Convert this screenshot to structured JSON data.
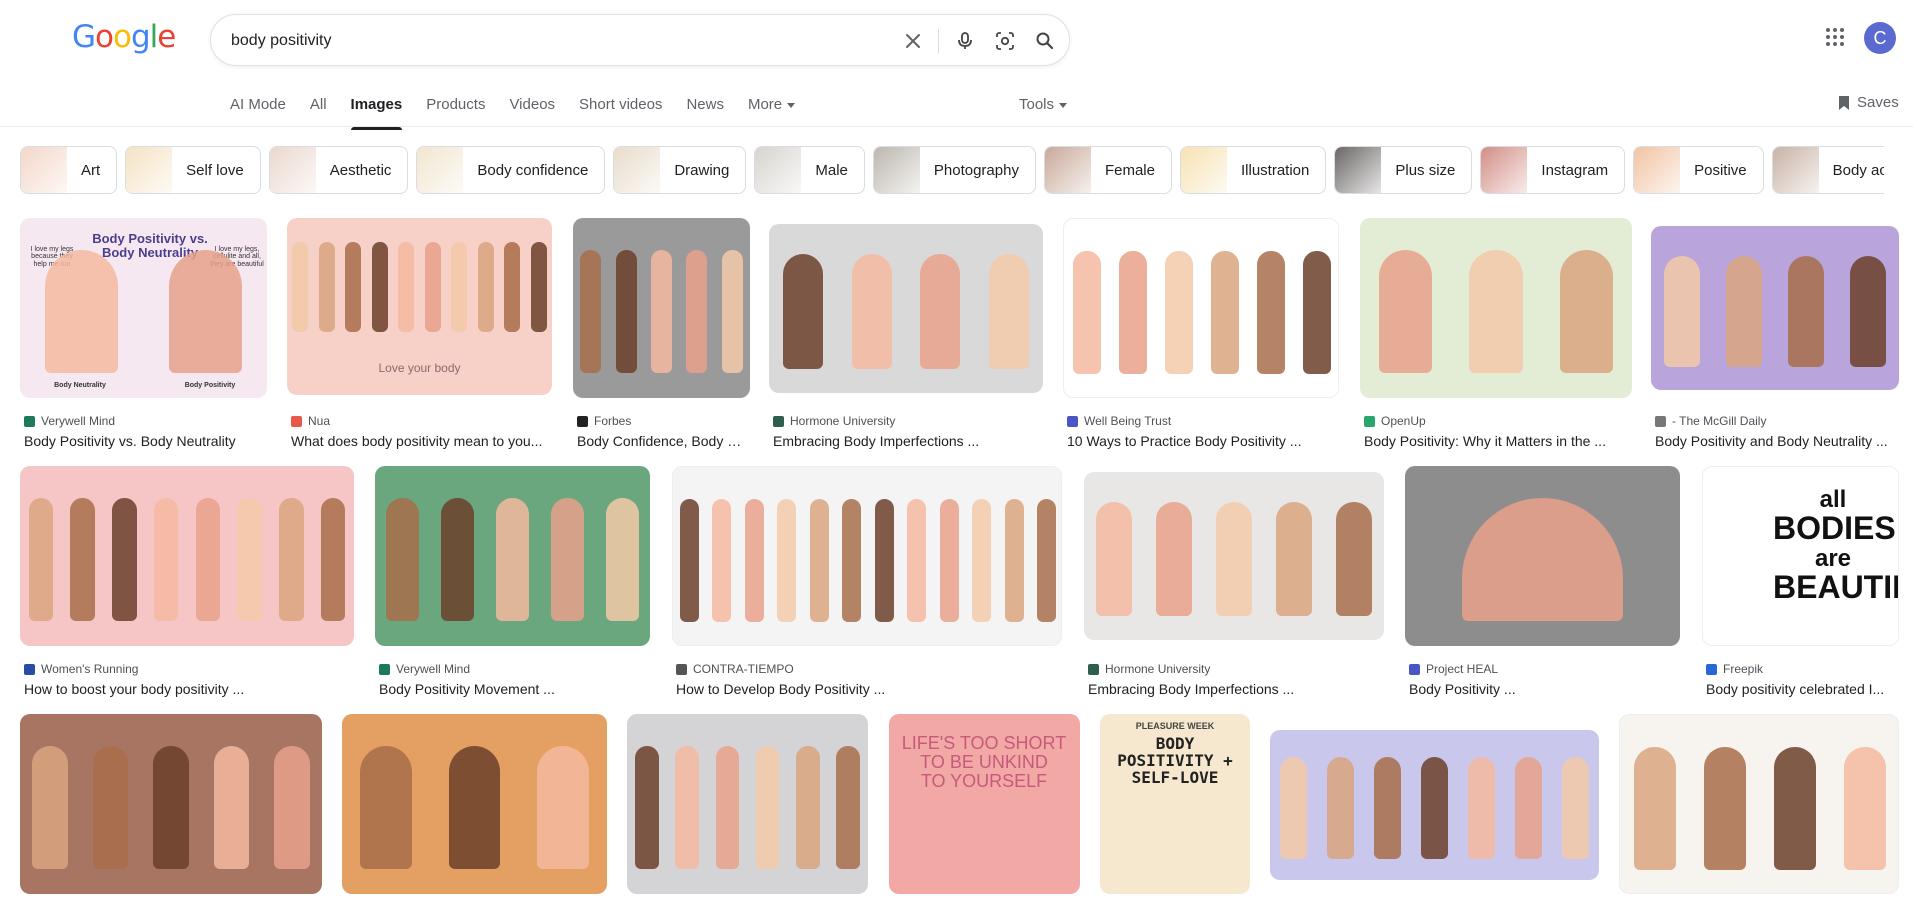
{
  "header": {
    "logo_letters": [
      {
        "ch": "G",
        "color": "#4285f4"
      },
      {
        "ch": "o",
        "color": "#ea4335"
      },
      {
        "ch": "o",
        "color": "#fbbc05"
      },
      {
        "ch": "g",
        "color": "#4285f4"
      },
      {
        "ch": "l",
        "color": "#34a853"
      },
      {
        "ch": "e",
        "color": "#ea4335"
      }
    ],
    "search_value": "body positivity",
    "avatar_letter": "C",
    "icons": [
      "close-icon",
      "mic-icon",
      "lens-icon",
      "search-icon",
      "apps-icon"
    ]
  },
  "nav": {
    "tabs": [
      "AI Mode",
      "All",
      "Images",
      "Products",
      "Videos",
      "Short videos",
      "News",
      "More"
    ],
    "active": "Images",
    "tools": "Tools",
    "saves": "Saves"
  },
  "chips": [
    {
      "label": "Art",
      "c": "#f3d7c9"
    },
    {
      "label": "Self love",
      "c": "#f4e3c4"
    },
    {
      "label": "Aesthetic",
      "c": "#ead8cf"
    },
    {
      "label": "Body confidence",
      "c": "#f1e6cf"
    },
    {
      "label": "Drawing",
      "c": "#e9dccb"
    },
    {
      "label": "Male",
      "c": "#d8d4cf"
    },
    {
      "label": "Photography",
      "c": "#bcb6ae"
    },
    {
      "label": "Female",
      "c": "#c9a99a"
    },
    {
      "label": "Illustration",
      "c": "#f7e2b3"
    },
    {
      "label": "Plus size",
      "c": "#6b6766"
    },
    {
      "label": "Instagram",
      "c": "#d38e86"
    },
    {
      "label": "Positive",
      "c": "#f2c3a2"
    },
    {
      "label": "Body acceptance",
      "c": "#c8b2a5"
    }
  ],
  "results": [
    {
      "source": "Verywell Mind",
      "title": "Body Positivity vs. Body Neutrality",
      "bg": "#f6e8f1",
      "fav": "#1a7a5b"
    },
    {
      "source": "Nua",
      "title": "What does body positivity mean to you...",
      "bg": "#f7d1c8",
      "fav": "#e8594a"
    },
    {
      "source": "Forbes",
      "title": "Body Confidence, Body P...",
      "bg": "#9a9a9a",
      "fav": "#222222"
    },
    {
      "source": "Hormone University",
      "title": "Embracing Body Imperfections ...",
      "bg": "#d9d9d9",
      "fav": "#2e5e4e"
    },
    {
      "source": "Well Being Trust",
      "title": "10 Ways to Practice Body Positivity ...",
      "bg": "#ffffff",
      "fav": "#4a56c6"
    },
    {
      "source": "OpenUp",
      "title": "Body Positivity: Why it Matters in the ...",
      "bg": "#e3ecd5",
      "fav": "#29a56e"
    },
    {
      "source": "- The McGill Daily",
      "title": "Body Positivity and Body Neutrality ...",
      "bg": "#b9a5dc",
      "fav": "#777777"
    },
    {
      "source": "Women's Running",
      "title": "How to boost your body positivity ...",
      "bg": "#f6c6c6",
      "fav": "#2a4aa8"
    },
    {
      "source": "Verywell Mind",
      "title": "Body Positivity Movement ...",
      "bg": "#6aa67e",
      "fav": "#1a7a5b"
    },
    {
      "source": "CONTRA-TIEMPO",
      "title": "How to Develop Body Positivity ...",
      "bg": "#f4f4f4",
      "fav": "#555555"
    },
    {
      "source": "Hormone University",
      "title": "Embracing Body Imperfections ...",
      "bg": "#e9e7e6",
      "fav": "#2e5e4e"
    },
    {
      "source": "Project HEAL",
      "title": "Body Positivity ...",
      "bg": "#8c8d8c",
      "fav": "#4a56c6"
    },
    {
      "source": "Freepik",
      "title": "Body positivity celebrated I...",
      "bg": "#ffffff",
      "fav": "#2a67d6"
    },
    {
      "source": "",
      "title": "",
      "bg": "#a87562",
      "fav": ""
    },
    {
      "source": "",
      "title": "",
      "bg": "#e3a062",
      "fav": ""
    },
    {
      "source": "",
      "title": "",
      "bg": "#d4d4d6",
      "fav": ""
    },
    {
      "source": "",
      "title": "",
      "bg": "#f2a9a5",
      "fav": ""
    },
    {
      "source": "",
      "title": "",
      "bg": "#f6e8cf",
      "fav": ""
    },
    {
      "source": "",
      "title": "",
      "bg": "#c9c8ec",
      "fav": ""
    },
    {
      "source": "",
      "title": "",
      "bg": "#f7f3ef",
      "fav": ""
    }
  ],
  "image_text": {
    "r0_heading": "Body Positivity vs. Body Neutrality",
    "r0_bubble_left": "I love my legs because they help me run",
    "r0_bubble_right": "I love my legs, cellulite and all, they are beautiful",
    "r0_caption_left": "Body Neutrality",
    "r0_caption_right": "Body Positivity",
    "r1_caption": "Love your body",
    "r12_text": [
      "all",
      "BODIES",
      "are",
      "BEAUTIFUL"
    ],
    "r16_text": [
      "LIFE'S TOO SHORT",
      "TO BE UNKIND",
      "TO YOURSELF"
    ],
    "r17_kicker": "PLEASURE WEEK",
    "r17_heading": [
      "BODY",
      "POSITIVITY +",
      "SELF-LOVE"
    ]
  }
}
